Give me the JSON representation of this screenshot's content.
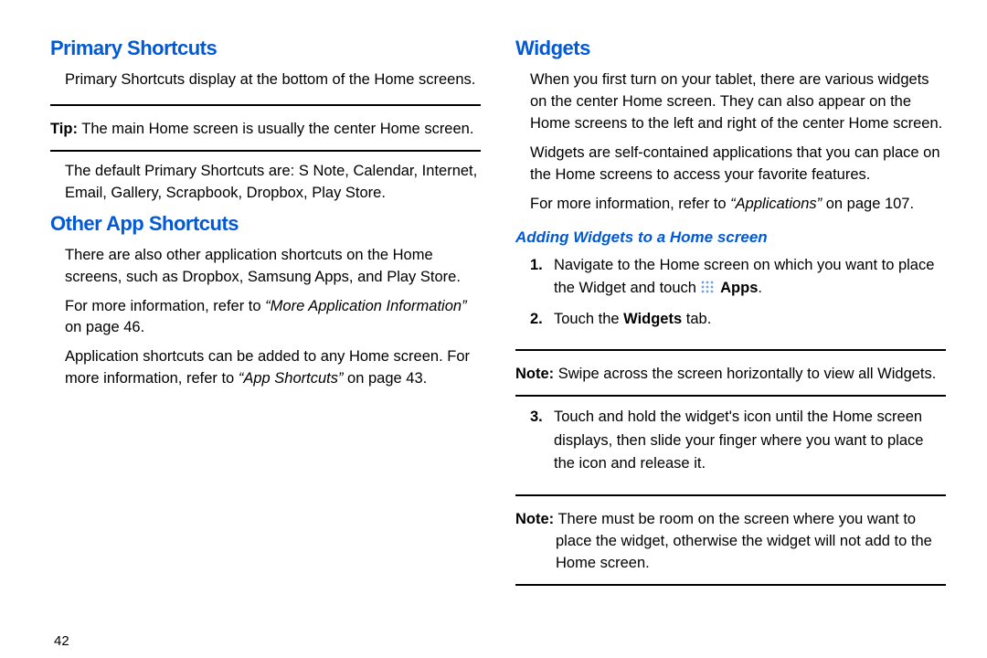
{
  "page_number": "42",
  "left": {
    "h_primary": "Primary Shortcuts",
    "p_primary_1": "Primary Shortcuts display at the bottom of the Home screens.",
    "tip_label": "Tip:",
    "tip_body": " The main Home screen is usually the center Home screen.",
    "p_primary_2": "The default Primary Shortcuts are: S Note, Calendar, Internet, Email, Gallery, Scrapbook, Dropbox, Play Store.",
    "h_other": "Other App Shortcuts",
    "p_other_1": "There are also other application shortcuts on the Home screens, such as Dropbox, Samsung Apps, and Play Store.",
    "p_other_2a": "For more information, refer to ",
    "p_other_2b": "“More Application Information”",
    "p_other_2c": " on page 46.",
    "p_other_3a": "Application shortcuts can be added to any Home screen. For more information, refer to ",
    "p_other_3b": "“App Shortcuts”",
    "p_other_3c": " on page 43."
  },
  "right": {
    "h_widgets": "Widgets",
    "p_w1": "When you first turn on your tablet, there are various widgets on the center Home screen. They can also appear on the Home screens to the left and right of the center Home screen.",
    "p_w2": "Widgets are self-contained applications that you can place on the Home screens to access your favorite features.",
    "p_w3a": "For more information, refer to ",
    "p_w3b": "“Applications”",
    "p_w3c": " on page 107.",
    "h_adding": "Adding Widgets to a Home screen",
    "step1_num": "1.",
    "step1a": "Navigate to the Home screen on which you want to place the Widget and touch ",
    "step1_apps": "Apps",
    "step1b": ".",
    "step2_num": "2.",
    "step2a": "Touch the ",
    "step2_widgets": "Widgets",
    "step2b": " tab.",
    "note1_label": "Note:",
    "note1_body": " Swipe across the screen horizontally to view all Widgets.",
    "step3_num": "3.",
    "step3": "Touch and hold the widget's icon until the Home screen displays, then slide your finger where you want to place the icon and release it.",
    "note2_label": "Note:",
    "note2_body": " There must be room on the screen where you want to place the widget, otherwise the widget will not add to the Home screen."
  }
}
